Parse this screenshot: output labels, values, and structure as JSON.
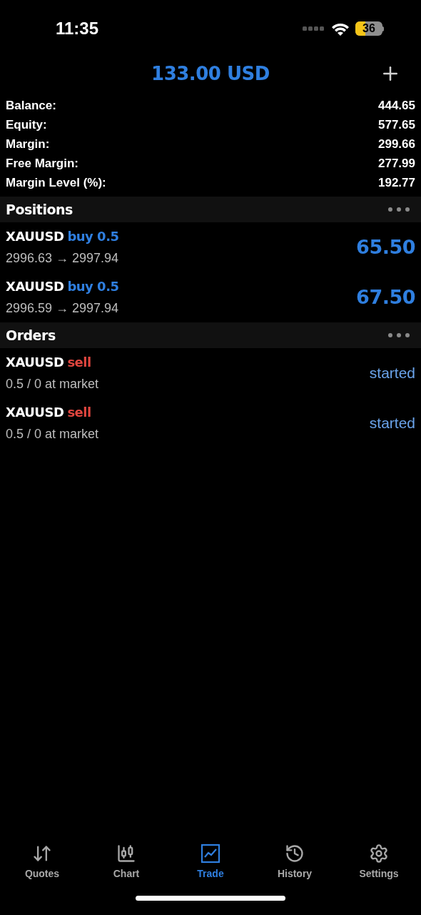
{
  "status_bar": {
    "time": "11:35",
    "battery": "36"
  },
  "header": {
    "title": "133.00 USD"
  },
  "summary": [
    {
      "label": "Balance:",
      "value": "444.65"
    },
    {
      "label": "Equity:",
      "value": "577.65"
    },
    {
      "label": "Margin:",
      "value": "299.66"
    },
    {
      "label": "Free Margin:",
      "value": "277.99"
    },
    {
      "label": "Margin Level (%):",
      "value": "192.77"
    }
  ],
  "positions": {
    "title": "Positions",
    "rows": [
      {
        "symbol": "XAUUSD",
        "kind": "buy",
        "action": "buy 0.5",
        "prices": "2996.63 → 2997.94",
        "profit": "65.50"
      },
      {
        "symbol": "XAUUSD",
        "kind": "buy",
        "action": "buy 0.5",
        "prices": "2996.59 → 2997.94",
        "profit": "67.50"
      }
    ]
  },
  "orders": {
    "title": "Orders",
    "rows": [
      {
        "symbol": "XAUUSD",
        "kind": "sell",
        "action": "sell",
        "detail": "0.5 / 0 at market",
        "status": "started"
      },
      {
        "symbol": "XAUUSD",
        "kind": "sell",
        "action": "sell",
        "detail": "0.5 / 0 at market",
        "status": "started"
      }
    ]
  },
  "tabs": [
    {
      "label": "Quotes",
      "selected": false
    },
    {
      "label": "Chart",
      "selected": false
    },
    {
      "label": "Trade",
      "selected": true
    },
    {
      "label": "History",
      "selected": false
    },
    {
      "label": "Settings",
      "selected": false
    }
  ]
}
